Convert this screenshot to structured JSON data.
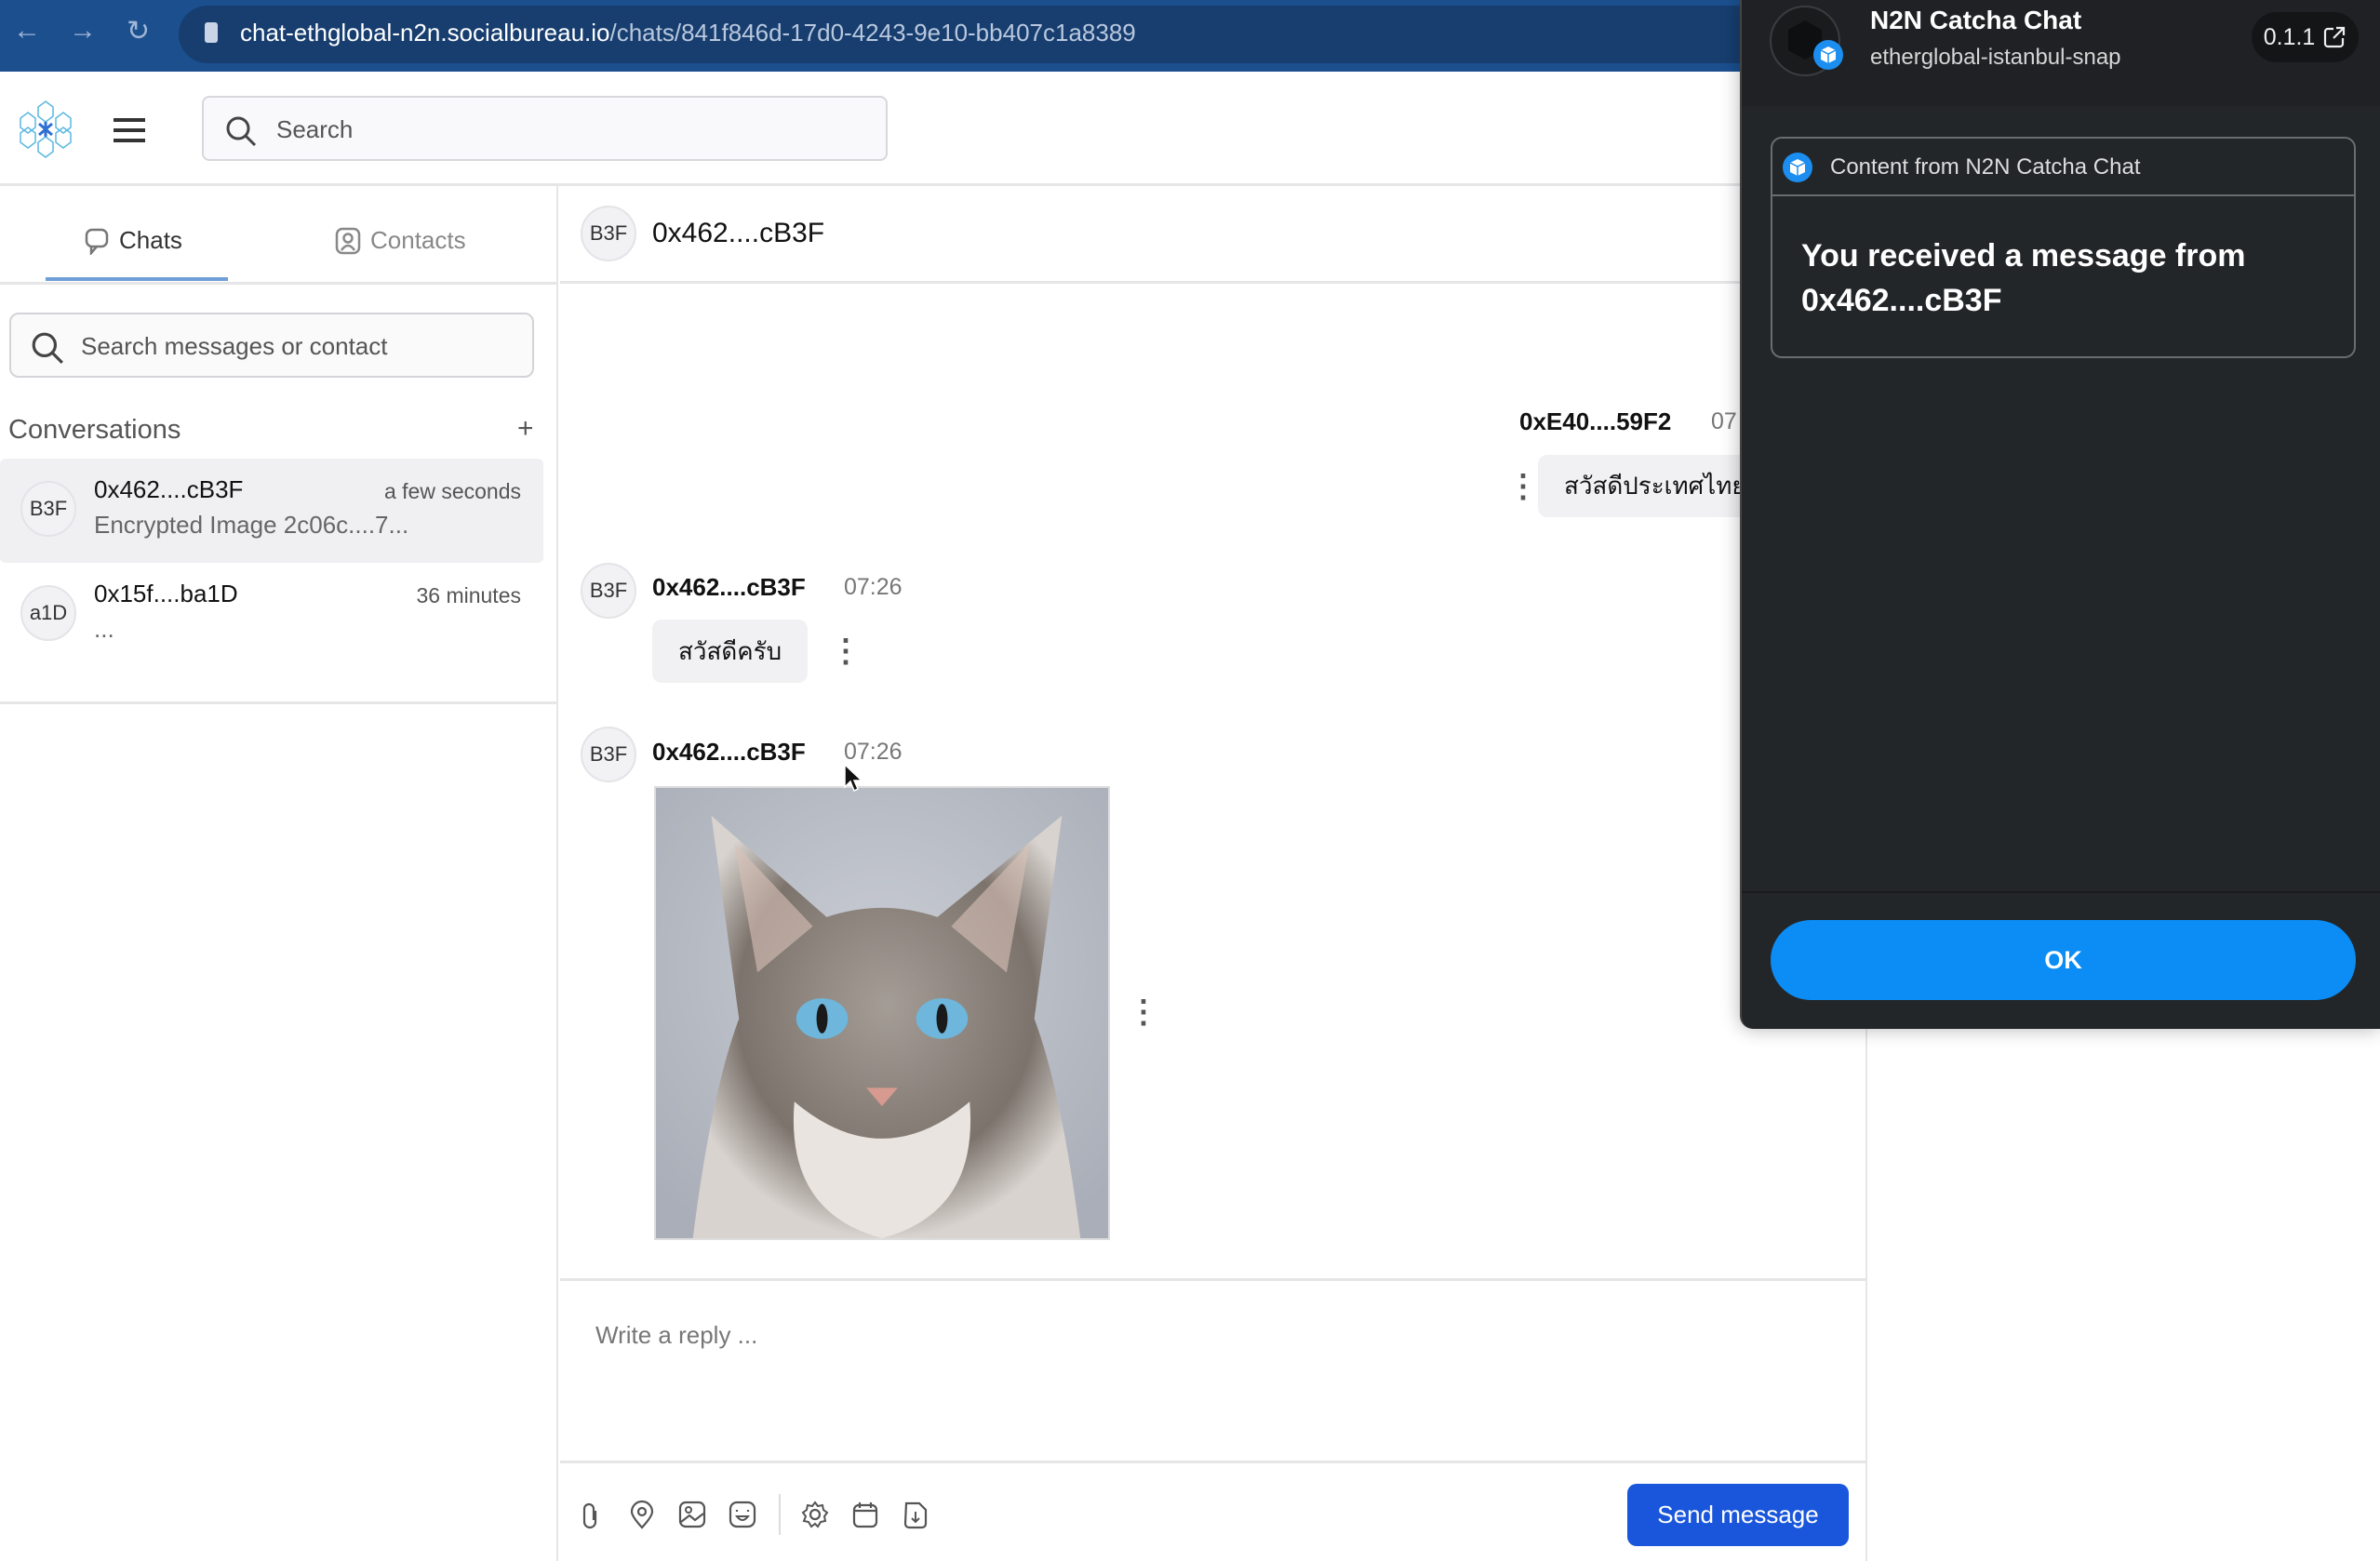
{
  "browser": {
    "url_host": "chat-ethglobal-n2n.socialbureau.io",
    "url_path": "/chats/841f846d-17d0-4243-9e10-bb407c1a8389"
  },
  "header": {
    "search_placeholder": "Search"
  },
  "sidebar": {
    "tabs": [
      {
        "label": "Chats",
        "active": true
      },
      {
        "label": "Contacts",
        "active": false
      }
    ],
    "search_placeholder": "Search messages or contact",
    "conversations_label": "Conversations",
    "add_label": "+",
    "conversations": [
      {
        "avatar": "B3F",
        "name": "0x462....cB3F",
        "time": "a few seconds",
        "preview": "Encrypted Image 2c06c....7...",
        "selected": true
      },
      {
        "avatar": "a1D",
        "name": "0x15f....ba1D",
        "time": "36 minutes",
        "preview": "..."
      }
    ]
  },
  "chat": {
    "header": {
      "avatar": "B3F",
      "title": "0x462....cB3F"
    },
    "messages": [
      {
        "sender": "0xE40....59F2",
        "time": "07",
        "text": "สวัสดีประเทศไทย",
        "outgoing": true
      },
      {
        "avatar": "B3F",
        "sender": "0x462....cB3F",
        "time": "07:26",
        "text": "สวัสดีครับ"
      },
      {
        "avatar": "B3F",
        "sender": "0x462....cB3F",
        "time": "07:26",
        "image": "cat-photo"
      }
    ],
    "reply_placeholder": "Write a reply ...",
    "toolbar_icons": [
      "paperclip-icon",
      "location-icon",
      "image-icon",
      "emoji-icon",
      "gear-icon",
      "calendar-icon",
      "file-download-icon"
    ],
    "send_label": "Send message"
  },
  "snap_dialog": {
    "title": "N2N Catcha Chat",
    "subtitle": "etherglobal-istanbul-snap",
    "version": "0.1.1",
    "content_header": "Content from N2N Catcha Chat",
    "message_line1": "You received a message from",
    "message_line2": "0x462....cB3F",
    "ok_label": "OK"
  },
  "colors": {
    "browser_bar": "#1b4f8e",
    "send_button": "#1a56db",
    "ok_button": "#0b8df5",
    "dialog_bg": "#232629"
  }
}
